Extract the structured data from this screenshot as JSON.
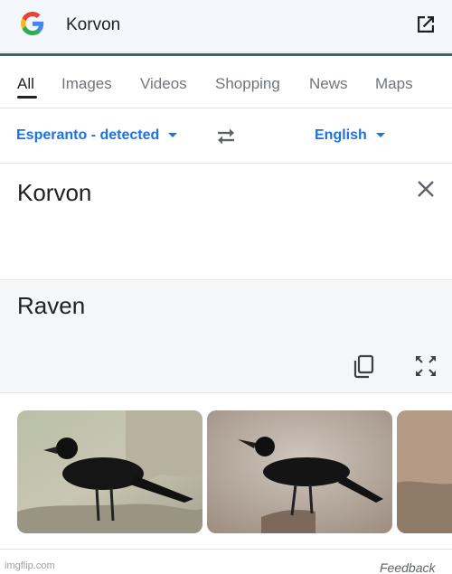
{
  "search": {
    "query": "Korvon"
  },
  "tabs": [
    {
      "label": "All",
      "active": true
    },
    {
      "label": "Images"
    },
    {
      "label": "Videos"
    },
    {
      "label": "Shopping"
    },
    {
      "label": "News"
    },
    {
      "label": "Maps"
    }
  ],
  "translate": {
    "source_lang": "Esperanto - detected",
    "target_lang": "English",
    "source_text": "Korvon",
    "result_text": "Raven"
  },
  "images": [
    {
      "alt": "raven on rock"
    },
    {
      "alt": "raven on branch"
    },
    {
      "alt": "raven partial"
    }
  ],
  "footer": {
    "watermark": "imgflip.com",
    "feedback": "Feedback"
  },
  "colors": {
    "accent": "#1a73e8",
    "teal_line": "#2e6b73",
    "result_bg": "#f5f6f7"
  }
}
